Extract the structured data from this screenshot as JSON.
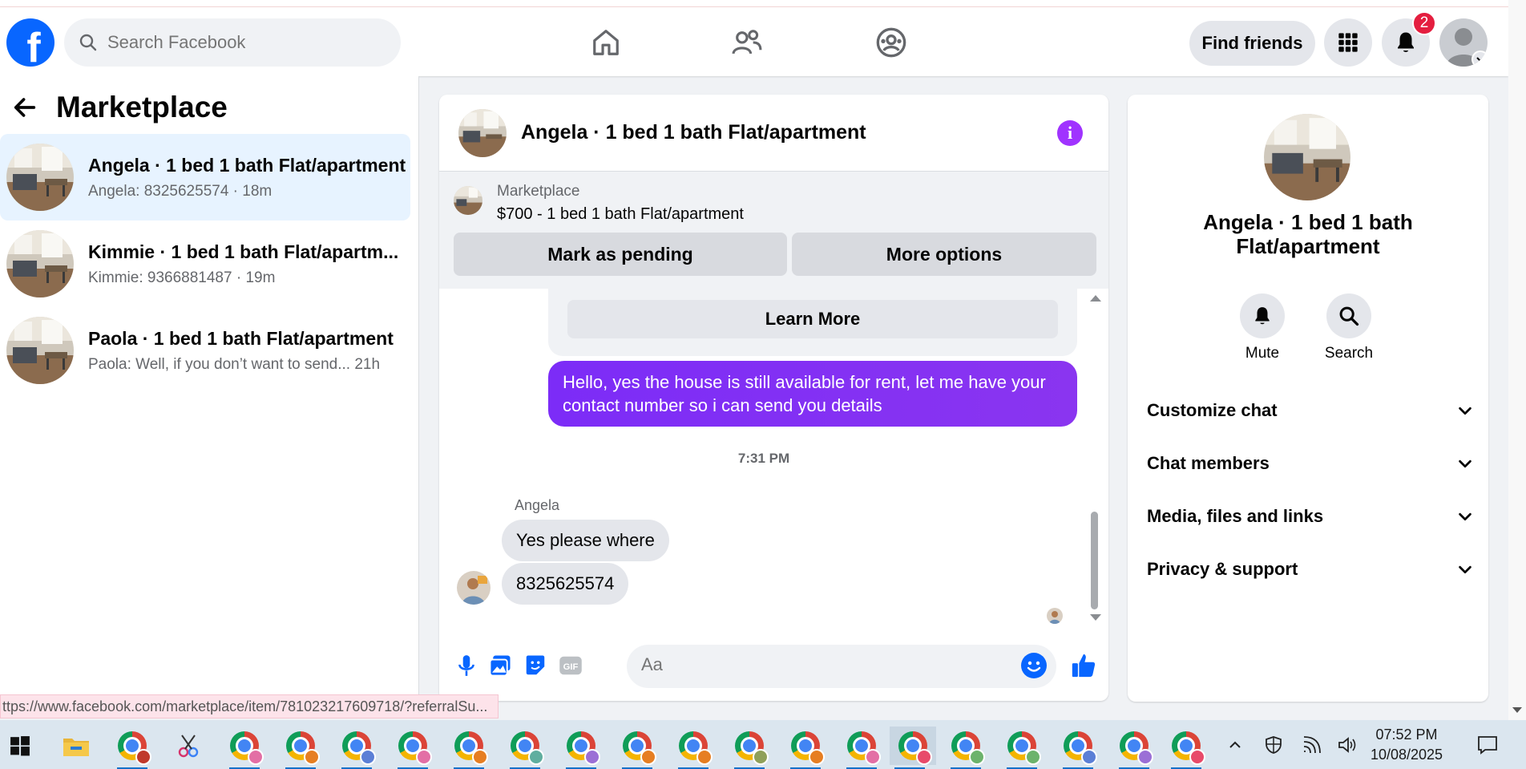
{
  "header": {
    "logo_letter": "f",
    "search_placeholder": "Search Facebook",
    "find_friends_label": "Find friends",
    "notifications_count": "2",
    "nav_icons": [
      "home-icon",
      "friends-icon",
      "groups-icon"
    ]
  },
  "left": {
    "title": "Marketplace",
    "conversations": [
      {
        "title": "Angela · 1 bed 1 bath Flat/apartment",
        "preview": "Angela: 8325625574 · 18m",
        "active": true
      },
      {
        "title": "Kimmie · 1 bed 1 bath Flat/apartm...",
        "preview": "Kimmie: 9366881487 · 19m",
        "active": false
      },
      {
        "title": "Paola · 1 bed 1 bath Flat/apartment",
        "preview": "Paola: Well, if you don’t want to send... 21h",
        "active": false
      }
    ]
  },
  "chat": {
    "header_title": "Angela · 1 bed 1 bath Flat/apartment",
    "listing_source": "Marketplace",
    "listing_title": "$700 - 1 bed 1 bath Flat/apartment",
    "mark_pending_label": "Mark as pending",
    "more_options_label": "More options",
    "learn_more_label": "Learn More",
    "sent_message": "Hello, yes the house is still available for rent, let me have your contact number so i can send you details",
    "timestamp": "7:31 PM",
    "sender_name": "Angela",
    "received_messages": [
      "Yes please where",
      "8325625574"
    ],
    "input_placeholder": "Aa"
  },
  "details": {
    "title": "Angela · 1 bed 1 bath Flat/apartment",
    "mute_label": "Mute",
    "search_label": "Search",
    "sections": [
      "Customize chat",
      "Chat members",
      "Media, files and links",
      "Privacy & support"
    ]
  },
  "status_url": "ttps://www.facebook.com/marketplace/item/781023217609718/?referralSu...",
  "taskbar": {
    "time": "07:52 PM",
    "date": "10/08/2025"
  },
  "colors": {
    "brand": "#0866ff",
    "sent_bubble": "#7c2cf7",
    "active_conversation": "#e7f3ff",
    "notification_badge": "#e41e3f"
  }
}
